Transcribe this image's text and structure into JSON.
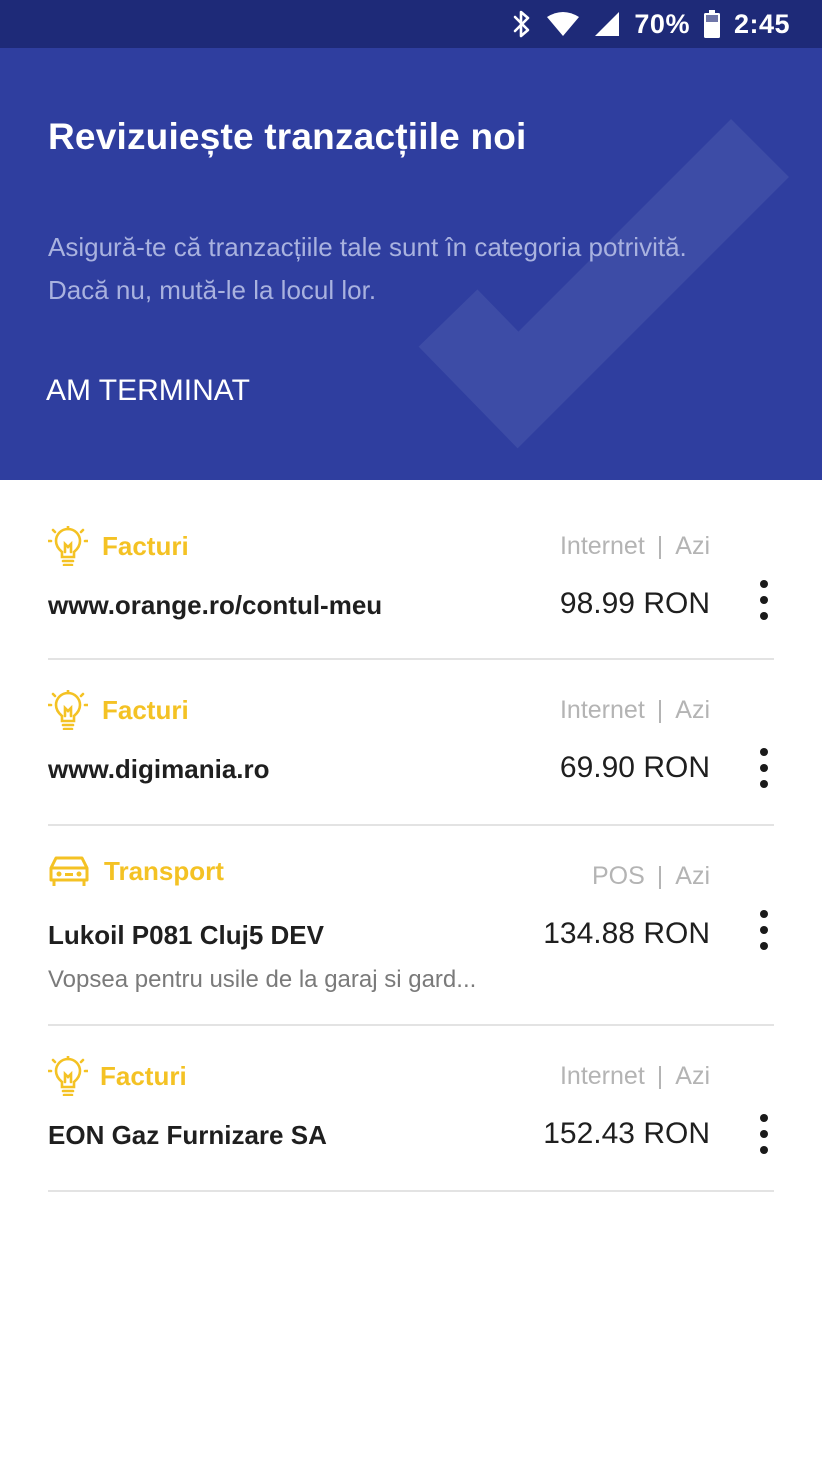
{
  "status_bar": {
    "battery": "70%",
    "time": "2:45",
    "icons": [
      "bluetooth-icon",
      "wifi-icon",
      "cell-signal-icon",
      "battery-icon"
    ]
  },
  "header": {
    "title": "Revizuiește tranzacțiile noi",
    "subtitle": "Asigură-te că tranzacțiile tale sunt în categoria potrivită. Dacă nu, mută-le la locul lor.",
    "done_label": "AM TERMINAT",
    "background_color": "#2f3e9f"
  },
  "accent_color": "#f4c224",
  "transactions": [
    {
      "category": "Facturi",
      "category_icon": "lightbulb-icon",
      "channel": "Internet",
      "separator": "|",
      "date": "Azi",
      "merchant": "www.orange.ro/contul-meu",
      "amount": "98.99 RON",
      "note": ""
    },
    {
      "category": "Facturi",
      "category_icon": "lightbulb-icon",
      "channel": "Internet",
      "separator": "|",
      "date": "Azi",
      "merchant": "www.digimania.ro",
      "amount": "69.90 RON",
      "note": ""
    },
    {
      "category": "Transport",
      "category_icon": "car-icon",
      "channel": "POS",
      "separator": "|",
      "date": "Azi",
      "merchant": "Lukoil P081 Cluj5 DEV",
      "amount": "134.88 RON",
      "note": "Vopsea pentru usile de la garaj si gard..."
    },
    {
      "category": "Facturi",
      "category_icon": "lightbulb-icon",
      "channel": "Internet",
      "separator": "|",
      "date": "Azi",
      "merchant": "EON Gaz Furnizare SA",
      "amount": "152.43 RON",
      "note": ""
    }
  ]
}
